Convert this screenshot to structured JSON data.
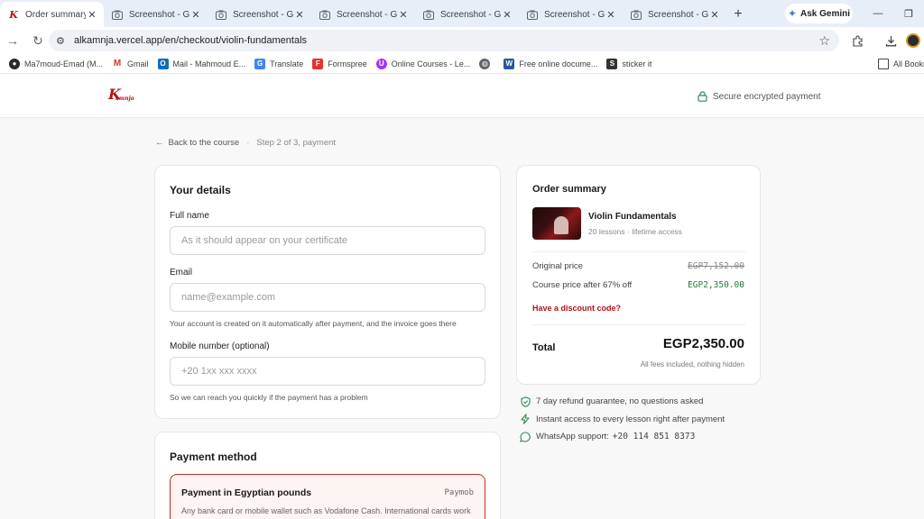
{
  "browser": {
    "tabs": [
      {
        "title": "Order summary -",
        "active": true
      },
      {
        "title": "Screenshot - GoF",
        "active": false
      },
      {
        "title": "Screenshot - GoF",
        "active": false
      },
      {
        "title": "Screenshot - GoF",
        "active": false
      },
      {
        "title": "Screenshot - GoF",
        "active": false
      },
      {
        "title": "Screenshot - GoF",
        "active": false
      },
      {
        "title": "Screenshot - GoF",
        "active": false
      }
    ],
    "new_tab": "+",
    "gemini_label": "Ask Gemini",
    "url": "alkamnja.vercel.app/en/checkout/violin-fundamentals",
    "bookmarks": [
      {
        "label": "Ma7moud-Emad (M...",
        "icon": "github-icon",
        "color": "#24292f"
      },
      {
        "label": "Gmail",
        "icon": "gmail-icon",
        "color": "#d93025"
      },
      {
        "label": "Mail - Mahmoud E...",
        "icon": "outlook-icon",
        "color": "#0f6cbd"
      },
      {
        "label": "Translate",
        "icon": "translate-icon",
        "color": "#4285f4"
      },
      {
        "label": "Formspree",
        "icon": "formspree-icon",
        "color": "#e5322d"
      },
      {
        "label": "Online Courses - Le...",
        "icon": "udemy-icon",
        "color": "#a435f0"
      },
      {
        "label": "",
        "icon": "globe-icon",
        "color": "#5f6368"
      },
      {
        "label": "Free online docume...",
        "icon": "word-icon",
        "color": "#2b579a"
      },
      {
        "label": "sticker it",
        "icon": "sticker-icon",
        "color": "#333333"
      }
    ],
    "all_bookmarks": "All Bookm"
  },
  "site": {
    "secure_label": "Secure encrypted payment"
  },
  "breadcrumb": {
    "back": "Back to the course",
    "step": "Step 2 of 3, payment"
  },
  "details": {
    "heading": "Your details",
    "full_name_label": "Full name",
    "full_name_placeholder": "As it should appear on your certificate",
    "email_label": "Email",
    "email_placeholder": "name@example.com",
    "email_hint": "Your account is created on it automatically after payment, and the invoice goes there",
    "mobile_label": "Mobile number (optional)",
    "mobile_placeholder": "+20 1xx xxx xxxx",
    "mobile_hint": "So we can reach you quickly if the payment has a problem"
  },
  "payment": {
    "heading": "Payment method",
    "option_name": "Payment in Egyptian pounds",
    "option_provider": "Paymob",
    "option_desc": "Any bank card or mobile wallet such as Vodafone Cash. International cards work"
  },
  "summary": {
    "heading": "Order summary",
    "course_title": "Violin Fundamentals",
    "course_meta": "20 lessons · lifetime access",
    "original_label": "Original price",
    "original_value": "EGP7,152.00",
    "discount_label": "Course price after 67% off",
    "discount_value": "EGP2,350.00",
    "discount_link": "Have a discount code?",
    "total_label": "Total",
    "total_value": "EGP2,350.00",
    "fees_note": "All fees included, nothing hidden"
  },
  "perks": {
    "refund": "7 day refund guarantee, no questions asked",
    "access": "Instant access to every lesson right after payment",
    "whatsapp_label": "WhatsApp support:",
    "whatsapp_number": "+20 114 851 8373"
  },
  "colors": {
    "brand": "#b3121c",
    "success": "#1e7e3a",
    "tab_strip": "#e8eef7"
  }
}
